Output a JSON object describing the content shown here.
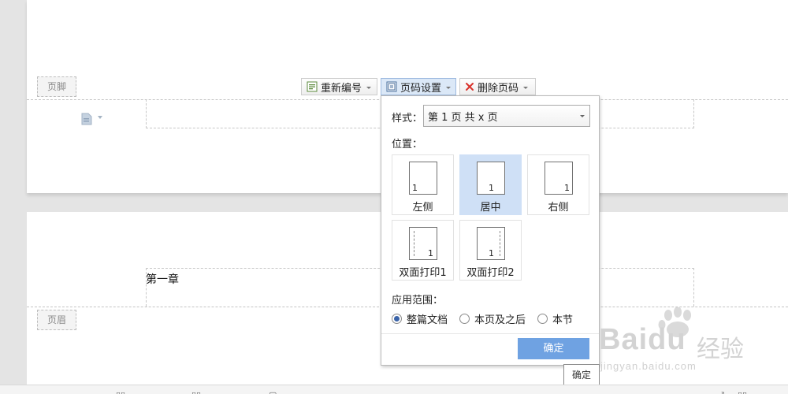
{
  "page_top": {
    "footer_tag": "页脚"
  },
  "page_bottom": {
    "header_tag": "页眉",
    "body_text": "第一章"
  },
  "toolbar": {
    "renumber_label": "重新编号",
    "page_setup_label": "页码设置",
    "delete_label": "删除页码"
  },
  "panel": {
    "style_label": "样式：",
    "style_value": "第 1 页 共 x 页",
    "position_label": "位置：",
    "positions": [
      {
        "label": "左侧",
        "num": "1"
      },
      {
        "label": "居中",
        "num": "1"
      },
      {
        "label": "右侧",
        "num": "1"
      },
      {
        "label": "双面打印1",
        "num": "1"
      },
      {
        "label": "双面打印2",
        "num": "1"
      }
    ],
    "selected_position": "居中",
    "scope_label": "应用范围：",
    "scope_options": [
      "整篇文档",
      "本页及之后",
      "本节"
    ],
    "selected_scope": "整篇文档",
    "ok_label": "确定"
  },
  "tooltip": "确定",
  "watermark": {
    "brand": "Baidu",
    "brand_cn": "经验",
    "url": "jingyan.baidu.com"
  },
  "colors": {
    "accent": "#6fa2e2",
    "selected_tile": "#cfe0f6",
    "delete_icon": "#d9322b"
  }
}
